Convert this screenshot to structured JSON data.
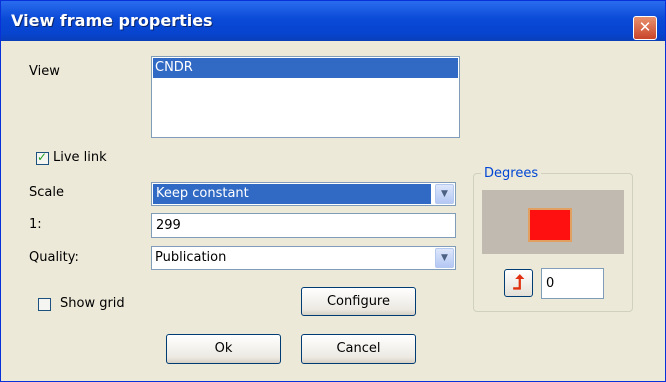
{
  "window": {
    "title": "View frame properties",
    "close_symbol": "✕"
  },
  "view": {
    "label": "View",
    "items": [
      "CNDR"
    ],
    "selected": "CNDR"
  },
  "live_link": {
    "label": "Live link",
    "checked": true
  },
  "scale": {
    "label": "Scale",
    "value": "Keep constant"
  },
  "ratio": {
    "label": "1:",
    "value": "299"
  },
  "quality": {
    "label": "Quality:",
    "value": "Publication"
  },
  "show_grid": {
    "label": "Show grid",
    "checked": false
  },
  "buttons": {
    "configure": "Configure",
    "ok": "Ok",
    "cancel": "Cancel"
  },
  "degrees": {
    "group_label": "Degrees",
    "value": "0",
    "rotate_icon": "rotate-arrow-icon"
  },
  "icons": {
    "dropdown": "▼",
    "check": "✓",
    "rotate": "⮥"
  },
  "colors": {
    "title_bar": "#0a4ad6",
    "selection": "#316ac5",
    "preview_fill": "#ff1010"
  }
}
